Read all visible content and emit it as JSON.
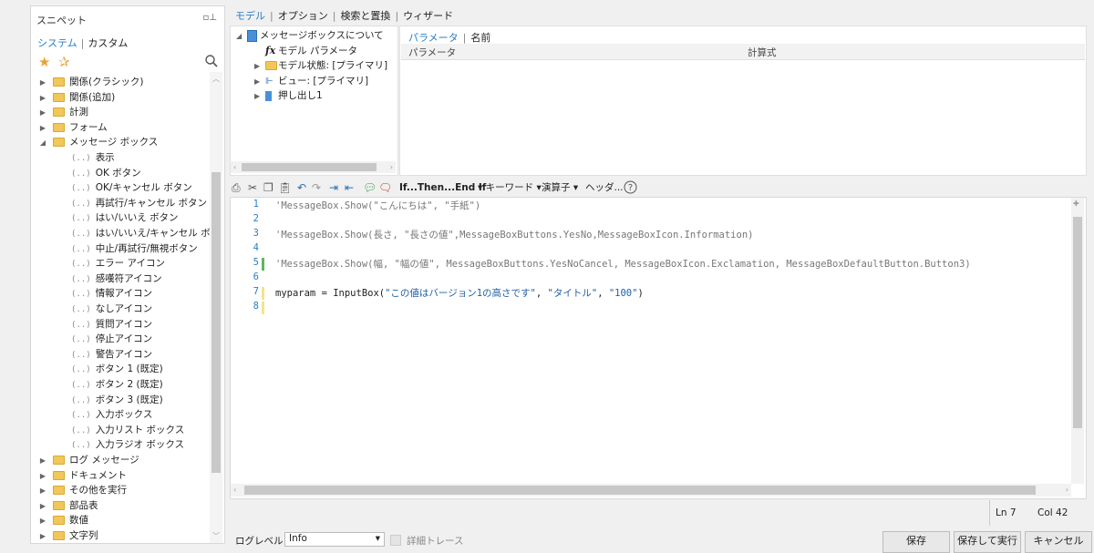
{
  "snippets": {
    "title": "スニペット",
    "pin_icon": "pin-icon",
    "tabs": [
      "システム",
      "カスタム"
    ],
    "active_tab": "システム",
    "tree": [
      {
        "label": "関係(クラシック)",
        "type": "folder",
        "expanded": false
      },
      {
        "label": "関係(追加)",
        "type": "folder",
        "expanded": false
      },
      {
        "label": "計測",
        "type": "folder",
        "expanded": false
      },
      {
        "label": "フォーム",
        "type": "folder",
        "expanded": false
      },
      {
        "label": "メッセージ ボックス",
        "type": "folder",
        "expanded": true
      },
      {
        "label": "表示",
        "type": "leaf"
      },
      {
        "label": "OK ボタン",
        "type": "leaf"
      },
      {
        "label": "OK/キャンセル ボタン",
        "type": "leaf"
      },
      {
        "label": "再試行/キャンセル ボタン",
        "type": "leaf"
      },
      {
        "label": "はい/いいえ ボタン",
        "type": "leaf"
      },
      {
        "label": "はい/いいえ/キャンセル ボタン",
        "type": "leaf"
      },
      {
        "label": "中止/再試行/無視ボタン",
        "type": "leaf"
      },
      {
        "label": "エラー アイコン",
        "type": "leaf"
      },
      {
        "label": "感嘆符アイコン",
        "type": "leaf"
      },
      {
        "label": "情報アイコン",
        "type": "leaf"
      },
      {
        "label": "なしアイコン",
        "type": "leaf"
      },
      {
        "label": "質問アイコン",
        "type": "leaf"
      },
      {
        "label": "停止アイコン",
        "type": "leaf"
      },
      {
        "label": "警告アイコン",
        "type": "leaf"
      },
      {
        "label": "ボタン 1 (既定)",
        "type": "leaf"
      },
      {
        "label": "ボタン 2 (既定)",
        "type": "leaf"
      },
      {
        "label": "ボタン 3 (既定)",
        "type": "leaf"
      },
      {
        "label": "入力ボックス",
        "type": "leaf"
      },
      {
        "label": "入力リスト ボックス",
        "type": "leaf"
      },
      {
        "label": "入力ラジオ ボックス",
        "type": "leaf"
      },
      {
        "label": "ログ メッセージ",
        "type": "folder",
        "expanded": false
      },
      {
        "label": "ドキュメント",
        "type": "folder",
        "expanded": false
      },
      {
        "label": "その他を実行",
        "type": "folder",
        "expanded": false
      },
      {
        "label": "部品表",
        "type": "folder",
        "expanded": false
      },
      {
        "label": "数値",
        "type": "folder",
        "expanded": false
      },
      {
        "label": "文字列",
        "type": "folder",
        "expanded": false
      }
    ]
  },
  "top_menu": [
    "モデル",
    "オプション",
    "検索と置換",
    "ウィザード"
  ],
  "model_tree": [
    {
      "label": "メッセージボックスについて",
      "icon": "part-icon",
      "level": 0,
      "toggle": "expanded"
    },
    {
      "label": "モデル パラメータ",
      "icon": "fx-icon",
      "level": 1,
      "toggle": "none"
    },
    {
      "label": "モデル状態: [プライマリ]",
      "icon": "folder-icon",
      "level": 1,
      "toggle": "collapsed"
    },
    {
      "label": "ビュー: [プライマリ]",
      "icon": "view-icon",
      "level": 1,
      "toggle": "collapsed"
    },
    {
      "label": "押し出し1",
      "icon": "extrude-icon",
      "level": 1,
      "toggle": "collapsed"
    }
  ],
  "params_panel": {
    "tabs": [
      "パラメータ",
      "名前"
    ],
    "columns": [
      "パラメータ",
      "計算式"
    ]
  },
  "toolbar": {
    "ifthen": "If...Then...End If",
    "keyword": "キーワード",
    "operator": "演算子",
    "header": "ヘッダ..."
  },
  "editor": {
    "lines": [
      {
        "n": "1",
        "text": "'MessageBox.Show(\"こんにちは\", \"手紙\")",
        "kind": "comment",
        "mark": ""
      },
      {
        "n": "2",
        "text": "",
        "kind": "blank",
        "mark": ""
      },
      {
        "n": "3",
        "text": "'MessageBox.Show(長さ, \"長さの値\",MessageBoxButtons.YesNo,MessageBoxIcon.Information)",
        "kind": "comment",
        "mark": ""
      },
      {
        "n": "4",
        "text": "",
        "kind": "blank",
        "mark": ""
      },
      {
        "n": "5",
        "text": "'MessageBox.Show(幅, \"幅の値\", MessageBoxButtons.YesNoCancel, MessageBoxIcon.Exclamation, MessageBoxDefaultButton.Button3)",
        "kind": "comment",
        "mark": "#5cb85c"
      },
      {
        "n": "6",
        "text": "",
        "kind": "blank",
        "mark": ""
      },
      {
        "n": "7",
        "code_a": "myparam = InputBox(",
        "code_b": "\"この値はバージョン1の高さです\"",
        "code_c": ", ",
        "code_d": "\"タイトル\"",
        "code_e": ", ",
        "code_f": "\"100\"",
        "code_g": ")",
        "kind": "code",
        "mark": "#f0e68c"
      },
      {
        "n": "8",
        "text": "",
        "kind": "blank",
        "mark": "#f0e68c"
      }
    ]
  },
  "status": {
    "line": "Ln 7",
    "col": "Col 42"
  },
  "bottom": {
    "log_level_label": "ログレベル",
    "log_level_value": "Info",
    "detail_trace": "詳細トレース",
    "buttons": [
      "保存",
      "保存して実行",
      "キャンセル"
    ]
  }
}
